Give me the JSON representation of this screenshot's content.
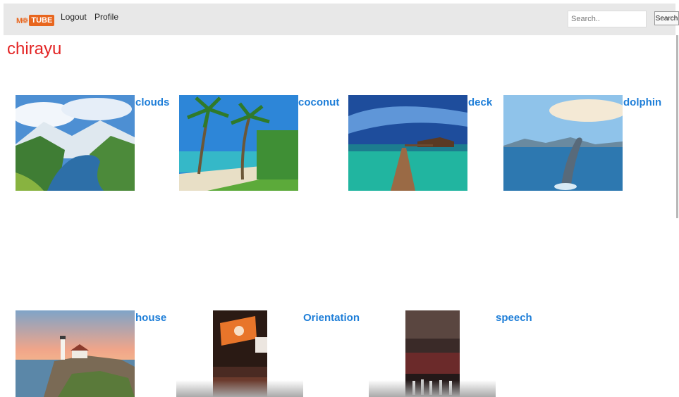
{
  "navbar": {
    "logo_mark": "M❁",
    "logo_tube": "TUBE",
    "links": [
      {
        "label": "Logout"
      },
      {
        "label": "Profile"
      }
    ],
    "search": {
      "placeholder": "Search..",
      "value": ""
    },
    "search_button": "Search"
  },
  "user": {
    "name": "chirayu"
  },
  "videos": [
    {
      "title": "clouds"
    },
    {
      "title": "coconut"
    },
    {
      "title": "deck"
    },
    {
      "title": "dolphin"
    },
    {
      "title": "house"
    },
    {
      "title": "Orientation"
    },
    {
      "title": "speech"
    }
  ],
  "colors": {
    "username": "#e32424",
    "link": "#1e7ed8",
    "navbar_bg": "#e8e8e8",
    "brand": "#e8661e"
  }
}
